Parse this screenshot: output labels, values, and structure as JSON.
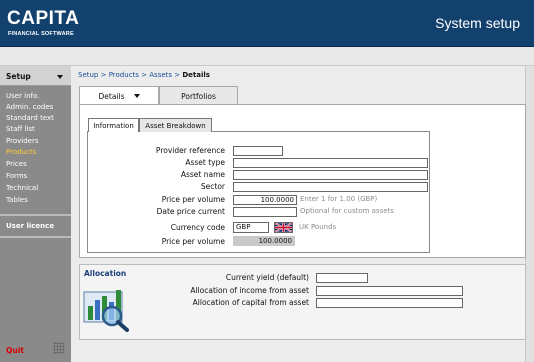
{
  "header": {
    "brand": "CAPITA",
    "brand_sub": "FINANCIAL SOFTWARE",
    "page_title": "System setup",
    "bg_color": "#12416e"
  },
  "sidebar": {
    "header_label": "Setup",
    "items": [
      {
        "label": "User info."
      },
      {
        "label": "Admin. codes"
      },
      {
        "label": "Standard text"
      },
      {
        "label": "Staff list"
      },
      {
        "label": "Providers"
      },
      {
        "label": "Products",
        "active": true
      },
      {
        "label": "Prices"
      },
      {
        "label": "Forms"
      },
      {
        "label": "Technical"
      },
      {
        "label": "Tables"
      }
    ],
    "licence_label": "User licence",
    "quit_label": "Quit",
    "active_color": "#ffcc33",
    "quit_color": "#d40000"
  },
  "breadcrumb": {
    "items": [
      "Setup",
      "Products",
      "Assets"
    ],
    "separator": " > ",
    "current": "Details"
  },
  "tabs": {
    "details": "Details",
    "portfolios": "Portfolios"
  },
  "subtabs": {
    "information": "Information",
    "asset_breakdown": "Asset Breakdown"
  },
  "form": {
    "provider_reference": {
      "label": "Provider reference",
      "value": ""
    },
    "asset_type": {
      "label": "Asset type",
      "value": ""
    },
    "asset_name": {
      "label": "Asset name",
      "value": ""
    },
    "sector": {
      "label": "Sector",
      "value": ""
    },
    "price_per_volume": {
      "label": "Price per volume",
      "value": "100.0000",
      "hint": "Enter 1 for 1.00 (GBP)"
    },
    "date_price_current": {
      "label": "Date price current",
      "value": "",
      "hint": "Optional for custom assets"
    },
    "currency_code": {
      "label": "Currency code",
      "value": "GBP",
      "currency_name": "UK Pounds",
      "flag_icon": "uk-flag-icon"
    },
    "price_per_volume_readonly": {
      "label": "Price per volume",
      "value": "100.0000"
    }
  },
  "allocation": {
    "title": "Allocation",
    "icon": "allocation-chart-magnifier-icon",
    "current_yield": {
      "label": "Current yield (default)",
      "value": ""
    },
    "income_allocation": {
      "label": "Allocation of income from asset",
      "value": ""
    },
    "capital_allocation": {
      "label": "Allocation of capital from asset",
      "value": ""
    }
  }
}
